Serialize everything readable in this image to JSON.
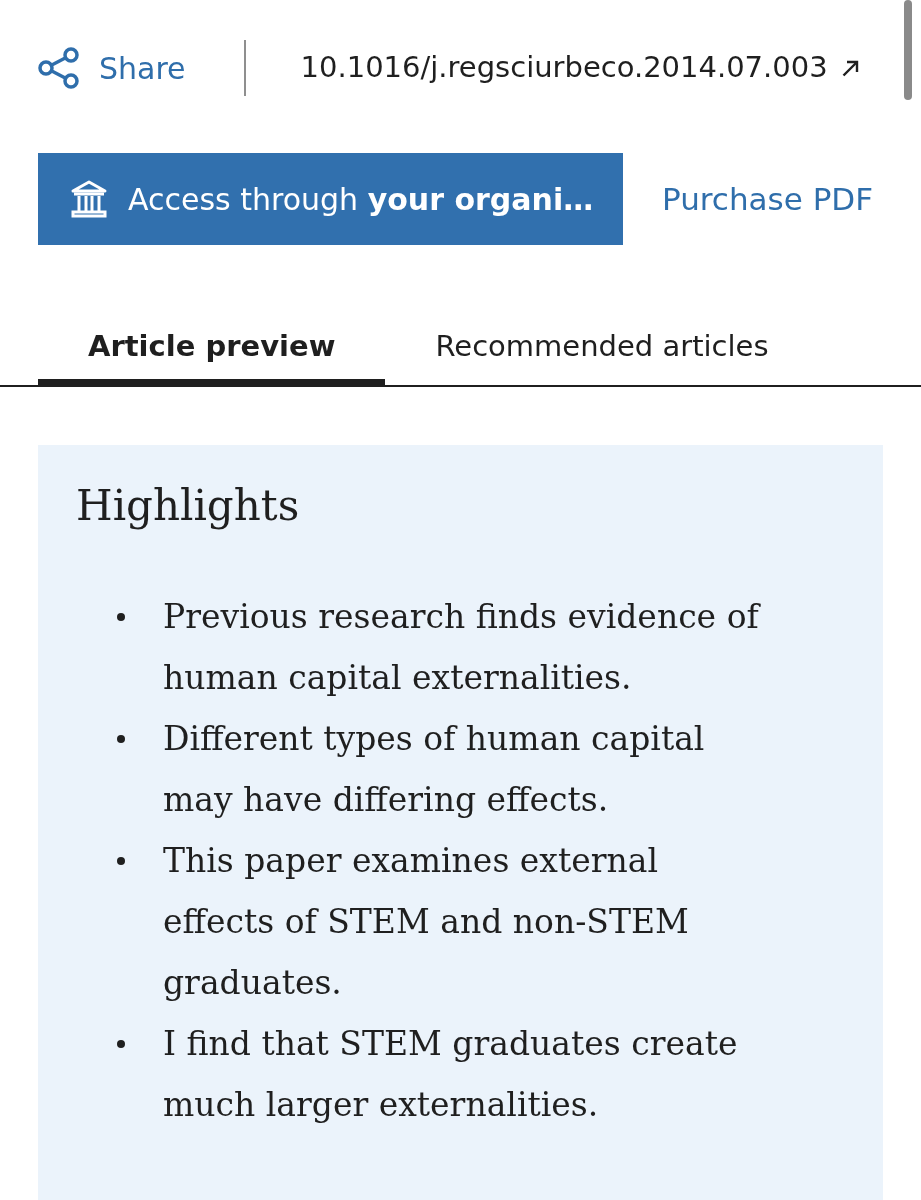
{
  "toolbar": {
    "share_label": "Share",
    "doi": "10.1016/j.regsciurbeco.2014.07.003"
  },
  "actions": {
    "access_button": "Access through **your organi…**",
    "purchase_link": "Purchase PDF"
  },
  "tabs": [
    {
      "label": "Article preview",
      "selected": true
    },
    {
      "label": "Recommended articles",
      "selected": false
    }
  ],
  "highlights": {
    "title": "Highlights",
    "items": [
      "Previous research finds evidence of human capital externalities.",
      "Different types of human capital may have differing effects.",
      "This paper examines external effects of STEM and non-STEM graduates.",
      "I find that STEM graduates create much larger externalities."
    ]
  }
}
